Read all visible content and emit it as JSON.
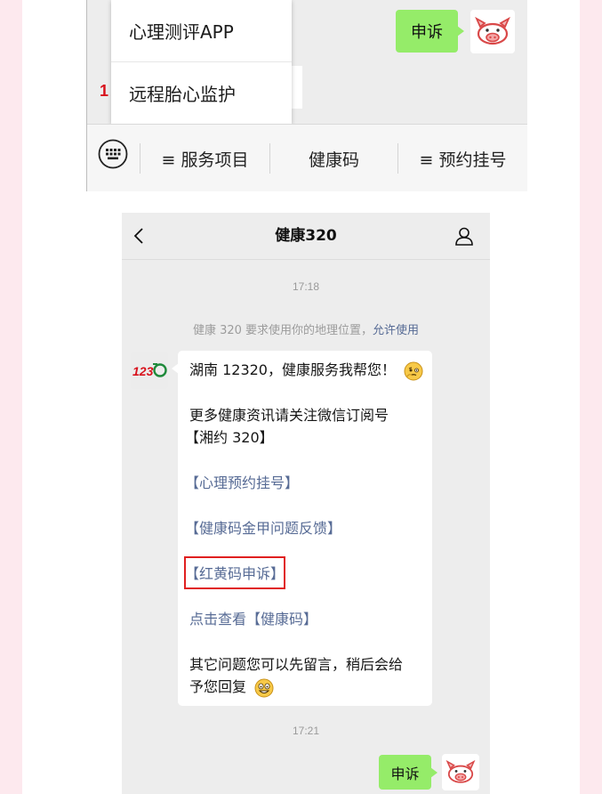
{
  "top_screenshot": {
    "popup_menu": {
      "items": [
        {
          "label": "心理测评APP"
        },
        {
          "label": "远程胎心监护"
        }
      ]
    },
    "sent_message": "申诉",
    "menu_bar": {
      "keyboard_icon": "keyboard-icon",
      "items": [
        {
          "label": "≡ 服务项目"
        },
        {
          "label": "健康码"
        },
        {
          "label": "≡ 预约挂号"
        }
      ]
    }
  },
  "chat_screen": {
    "header": {
      "back_icon": "chevron-left-icon",
      "title": "健康320",
      "profile_icon": "person-icon"
    },
    "time_1": "17:18",
    "system_message": {
      "text": "健康 320 要求使用你的地理位置，",
      "link": "允许使用"
    },
    "bot_avatar_text": "12320",
    "bot_message": {
      "greeting": "湖南 12320，健康服务我帮您！",
      "greeting_emoji": "thinking-face-emoji",
      "subscribe_line1": "更多健康资讯请关注微信订阅号",
      "subscribe_line2": "【湘约 320】",
      "link_1": "【心理预约挂号】",
      "link_2": "【健康码金甲问题反馈】",
      "link_3": "【红黄码申诉】",
      "link_4": "点击查看【健康码】",
      "other_line1": "其它问题您可以先留言，稍后会给",
      "other_line2": "予您回复",
      "other_emoji": "grinning-face-emoji"
    },
    "time_2": "17:21",
    "sent_message": "申诉",
    "colors": {
      "link": "#576b95",
      "sent_bubble": "#95ec69",
      "highlight_border": "#e02020"
    }
  }
}
